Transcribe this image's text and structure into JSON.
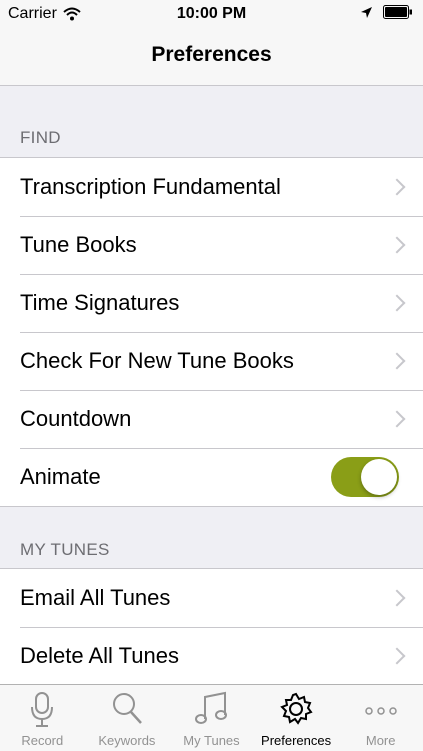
{
  "status_bar": {
    "carrier": "Carrier",
    "time": "10:00 PM",
    "icons": [
      "wifi-icon",
      "location-icon",
      "battery-icon"
    ]
  },
  "nav": {
    "title": "Preferences"
  },
  "sections": [
    {
      "header": "FIND",
      "rows": [
        {
          "label": "Transcription Fundamental",
          "accessory": "chevron"
        },
        {
          "label": "Tune Books",
          "accessory": "chevron"
        },
        {
          "label": "Time Signatures",
          "accessory": "chevron"
        },
        {
          "label": "Check For New Tune Books",
          "accessory": "chevron"
        },
        {
          "label": "Countdown",
          "accessory": "chevron"
        },
        {
          "label": "Animate",
          "accessory": "toggle",
          "on": true
        }
      ]
    },
    {
      "header": "MY TUNES",
      "rows": [
        {
          "label": "Email All Tunes",
          "accessory": "chevron"
        },
        {
          "label": "Delete All Tunes",
          "accessory": "chevron"
        }
      ]
    }
  ],
  "tab_bar": {
    "items": [
      {
        "label": "Record",
        "icon": "microphone-icon"
      },
      {
        "label": "Keywords",
        "icon": "search-icon"
      },
      {
        "label": "My Tunes",
        "icon": "music-note-icon"
      },
      {
        "label": "Preferences",
        "icon": "gear-icon",
        "active": true
      },
      {
        "label": "More",
        "icon": "more-icon"
      }
    ]
  },
  "colors": {
    "toggle_on": "#8a9e17",
    "background": "#efeff4",
    "separator": "#c8c7cc",
    "tab_inactive": "#929292"
  }
}
